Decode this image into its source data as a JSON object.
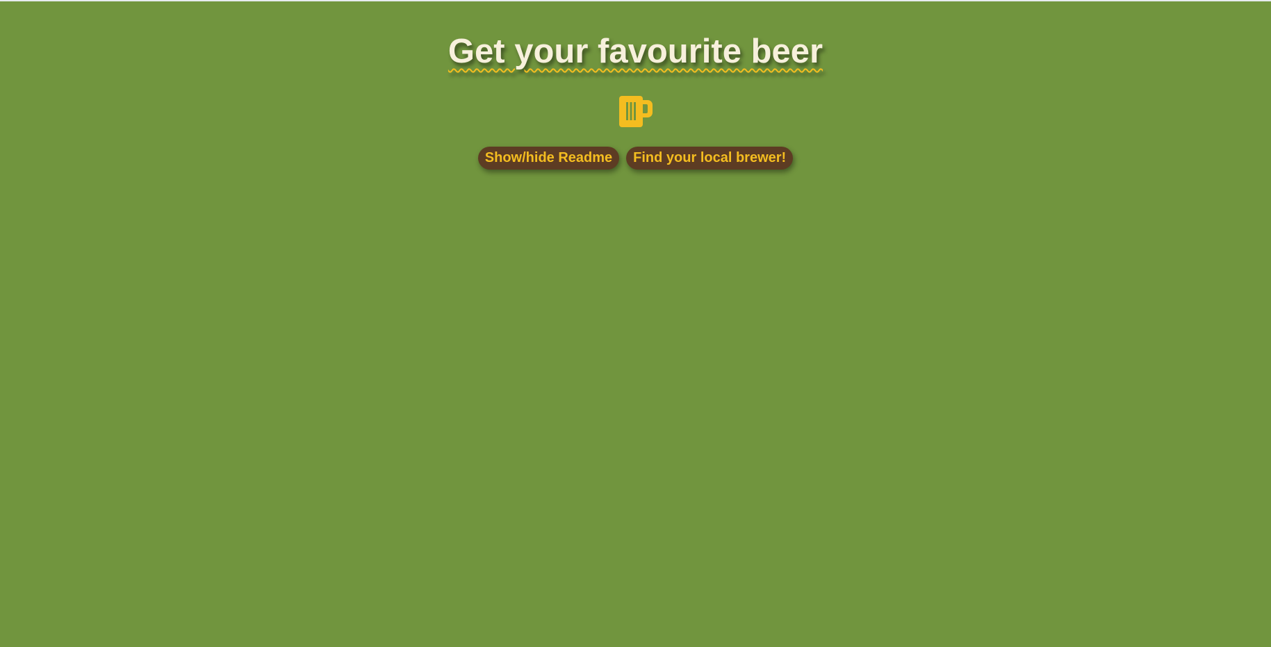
{
  "header": {
    "title": "Get your favourite beer"
  },
  "icon": {
    "name": "beer-mug-icon",
    "color": "#f4bd20"
  },
  "actions": {
    "readme_label": "Show/hide Readme",
    "brewer_label": "Find your local brewer!"
  },
  "colors": {
    "background": "#71953e",
    "title_text": "#f7f0dc",
    "underline": "#f4bd20",
    "button_bg": "#5d3c23",
    "button_text": "#f4bd20"
  }
}
